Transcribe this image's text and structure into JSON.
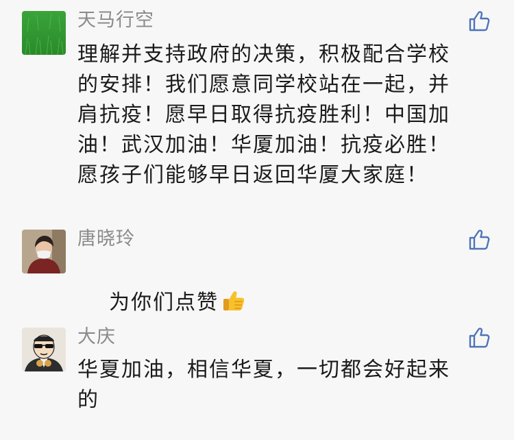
{
  "comments": [
    {
      "author": "天马行空",
      "avatar": "grass-avatar",
      "text": "理解并支持政府的决策，积极配合学校\n的安排！我们愿意同学校站在一起，并\n肩抗疫！愿早日取得抗疫胜利！中国加\n油！武汉加油！华厦加油！抗疫必胜！\n愿孩子们能够早日返回华厦大家庭！",
      "like_icon": "thumbs-up-outline-icon"
    },
    {
      "author": "唐晓玲",
      "avatar": "masked-person-avatar",
      "text": "为你们点赞",
      "emoji": "thumbs-up-emoji",
      "like_icon": "thumbs-up-outline-icon"
    },
    {
      "author": "大庆",
      "avatar": "cartoon-sunglasses-avatar",
      "text": "华夏加油，相信华夏，一切都会好起来\n的",
      "like_icon": "thumbs-up-outline-icon"
    }
  ],
  "colors": {
    "background": "#f7f7f7",
    "name": "#8a8a8a",
    "text": "#1a1a1a",
    "like_icon": "#4d74b8"
  }
}
